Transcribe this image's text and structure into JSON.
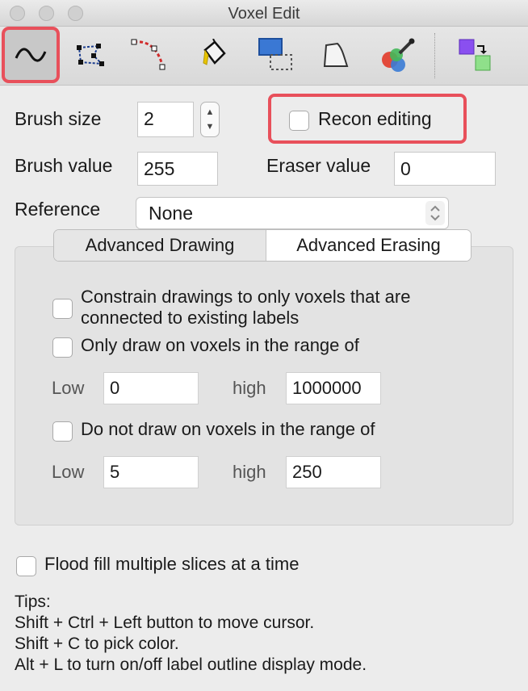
{
  "window": {
    "title": "Voxel Edit"
  },
  "toolbar": {
    "tools": [
      {
        "name": "freehand",
        "icon": "freehand-curve-icon",
        "active": true
      },
      {
        "name": "polyline",
        "icon": "polyline-icon"
      },
      {
        "name": "livewire",
        "icon": "livewire-icon"
      },
      {
        "name": "fill",
        "icon": "paint-bucket-icon"
      },
      {
        "name": "contour",
        "icon": "contour-icon"
      },
      {
        "name": "color-picker",
        "icon": "color-picker-icon"
      },
      {
        "name": "clone",
        "icon": "clone-icon"
      }
    ],
    "highlight_color": "#e8505b"
  },
  "form": {
    "brush_size_label": "Brush size",
    "brush_size_value": "2",
    "recon_editing_label": "Recon editing",
    "brush_value_label": "Brush value",
    "brush_value": "255",
    "eraser_value_label": "Eraser value",
    "eraser_value": "0",
    "reference_label": "Reference",
    "reference_value": "None"
  },
  "tabs": {
    "drawing": "Advanced Drawing",
    "erasing": "Advanced Erasing"
  },
  "advanced": {
    "constrain_line1": "Constrain drawings to only voxels that are",
    "constrain_line2": "connected to existing labels",
    "only_draw_label": "Only draw on voxels in the range of",
    "only_low_label": "Low",
    "only_low_value": "0",
    "only_high_label": "high",
    "only_high_value": "1000000",
    "not_draw_label": "Do not draw on voxels in the range of",
    "not_low_label": "Low",
    "not_low_value": "5",
    "not_high_label": "high",
    "not_high_value": "250"
  },
  "flood_fill_label": "Flood fill multiple slices at a time",
  "tips": {
    "heading": "Tips:",
    "line1": "Shift + Ctrl + Left button to move cursor.",
    "line2": "Shift + C to pick color.",
    "line3": "Alt + L to turn on/off label outline display mode."
  }
}
